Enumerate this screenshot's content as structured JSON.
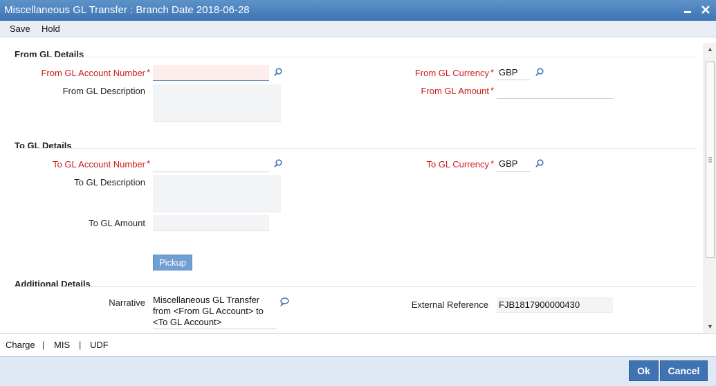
{
  "window": {
    "title": "Miscellaneous GL Transfer : Branch Date 2018-06-28"
  },
  "menu": {
    "save": "Save",
    "hold": "Hold"
  },
  "from_gl": {
    "section_title": "From GL Details",
    "account_number_label": "From GL Account Number",
    "account_number_value": "",
    "description_label": "From GL Description",
    "currency_label": "From GL Currency",
    "currency_value": "GBP",
    "amount_label": "From GL Amount",
    "amount_value": ""
  },
  "to_gl": {
    "section_title": "To GL Details",
    "account_number_label": "To GL Account Number",
    "account_number_value": "",
    "description_label": "To GL Description",
    "currency_label": "To GL Currency",
    "currency_value": "GBP",
    "amount_label": "To GL Amount",
    "amount_value": "",
    "pickup_label": "Pickup"
  },
  "additional": {
    "section_title": "Additional Details",
    "narrative_label": "Narrative",
    "narrative_value": "Miscellaneous GL Transfer\nfrom <From GL Account> to\n<To GL Account>",
    "external_ref_label": "External Reference",
    "external_ref_value": "FJB1817900000430"
  },
  "required_marker": "*",
  "bottom_links": {
    "charge": "Charge",
    "mis": "MIS",
    "udf": "UDF",
    "separator": "|"
  },
  "footer": {
    "ok": "Ok",
    "cancel": "Cancel"
  },
  "colors": {
    "title_bar": "#4a80bd",
    "required_label": "#cc1a1a",
    "button": "#3f73b1",
    "pickup_button": "#6f9fd3"
  }
}
